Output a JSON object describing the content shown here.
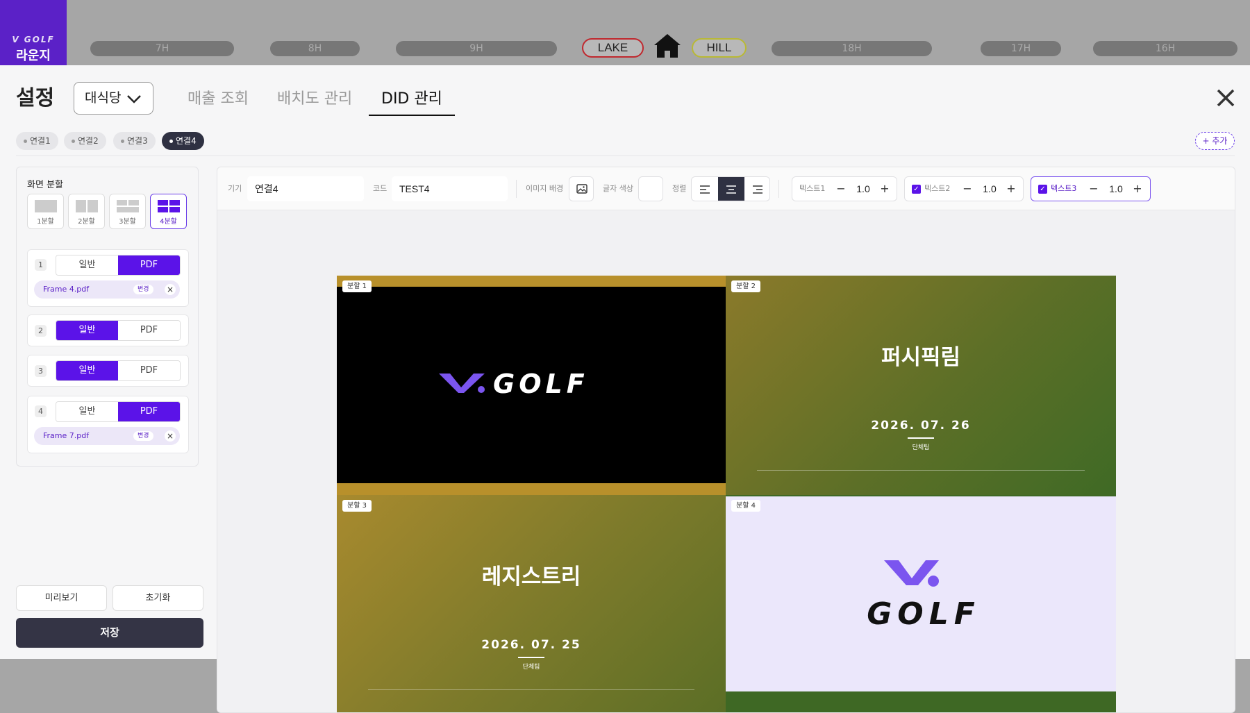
{
  "topbar": {
    "logo_brand": "V GOLF",
    "logo_name": "라운지",
    "holes": [
      "7H",
      "8H",
      "9H",
      "18H",
      "17H",
      "16H"
    ],
    "course_left": "LAKE",
    "course_right": "HILL",
    "colors": {
      "brand": "#5b21c7",
      "lake": "#c0282e",
      "hill": "#b9b935"
    }
  },
  "header": {
    "title": "설정",
    "venue_select": "대식당",
    "tabs": [
      "매출 조회",
      "배치도 관리",
      "DID 관리"
    ],
    "active_tab": "DID 관리"
  },
  "connections": {
    "items": [
      "연결1",
      "연결2",
      "연결3",
      "연결4"
    ],
    "active": "연결4",
    "add_label": "+ 추가"
  },
  "sidebar": {
    "split_label": "화면 분할",
    "split_options": [
      "1분할",
      "2분할",
      "3분할",
      "4분할"
    ],
    "selected_split": "4분할",
    "slots": [
      {
        "num": "1",
        "opt_a": "일반",
        "opt_b": "PDF",
        "selected": "PDF",
        "file": "Frame 4.pdf",
        "change": "변경"
      },
      {
        "num": "2",
        "opt_a": "일반",
        "opt_b": "PDF",
        "selected": "일반"
      },
      {
        "num": "3",
        "opt_a": "일반",
        "opt_b": "PDF",
        "selected": "일반"
      },
      {
        "num": "4",
        "opt_a": "일반",
        "opt_b": "PDF",
        "selected": "PDF",
        "file": "Frame 7.pdf",
        "change": "변경"
      }
    ],
    "preview_label": "미리보기",
    "reset_label": "초기화",
    "save_label": "저장"
  },
  "toolbar": {
    "device_label": "기기",
    "device_value": "연결4",
    "code_label": "코드",
    "code_value": "TEST4",
    "bg_image_label": "이미지 배경",
    "font_color_label": "글자 색상",
    "align_label": "정렬",
    "align_selected": "center",
    "text1": {
      "label": "텍스트1",
      "checked": false,
      "value": "1.0"
    },
    "text2": {
      "label": "텍스트2",
      "checked": true,
      "value": "1.0"
    },
    "text3": {
      "label": "텍스트3",
      "checked": true,
      "value": "1.0"
    }
  },
  "preview": {
    "panels": [
      {
        "tag": "분할 1",
        "content": "V.GOLF logo"
      },
      {
        "tag": "분할 2",
        "title": "퍼시픽림",
        "date": "2026. 07. 26",
        "org": "단체팀"
      },
      {
        "tag": "분할 3",
        "title": "레지스트리",
        "date": "2026. 07. 25",
        "org": "단체팀"
      },
      {
        "tag": "분할 4",
        "content": "V GOLF logo"
      }
    ],
    "logo_text": "GOLF"
  }
}
